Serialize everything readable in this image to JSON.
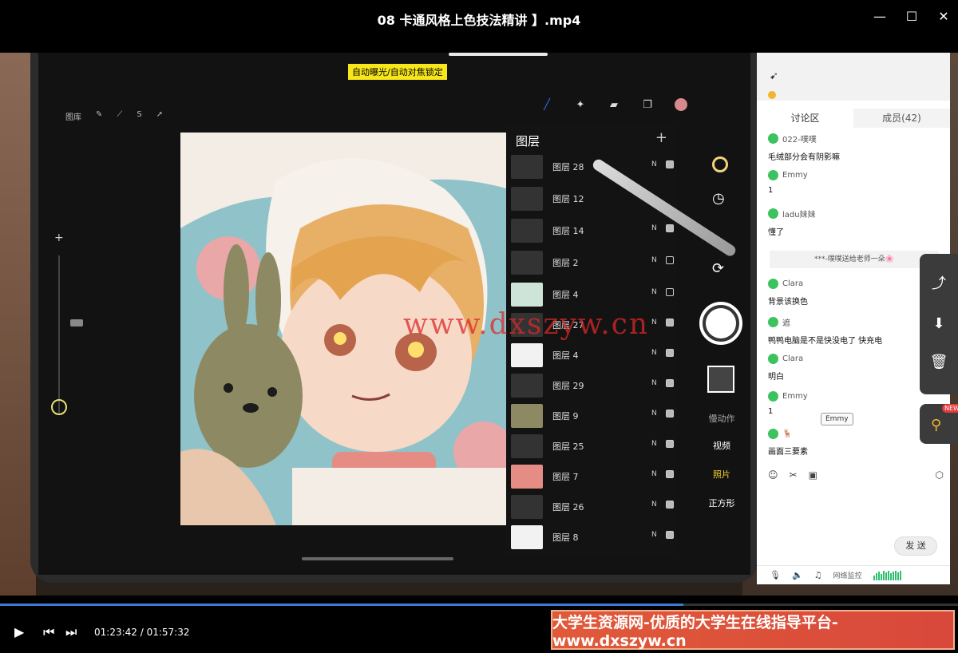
{
  "window": {
    "title": "08 卡通风格上色技法精讲 】.mp4",
    "minimize_icon": "minimize-icon",
    "maximize_icon": "maximize-icon",
    "close_icon": "close-icon"
  },
  "video": {
    "focus_label": "自动曝光/自动对焦锁定",
    "watermark": "www.dxszyw.cn",
    "procreate_toolbar": {
      "gallery": "图库",
      "icons": [
        "wrench-icon",
        "magic-wand-icon",
        "selection-icon",
        "arrow-icon"
      ],
      "right_icons": [
        "brush-icon",
        "smudge-icon",
        "eraser-icon",
        "layers-icon",
        "color-swatch-icon"
      ]
    },
    "layers": {
      "title": "图层",
      "items": [
        {
          "name": "图层 28",
          "mode": "N",
          "checked": true
        },
        {
          "name": "图层 12",
          "mode": "",
          "checked": false
        },
        {
          "name": "图层 14",
          "mode": "N",
          "checked": true
        },
        {
          "name": "图层 2",
          "mode": "N",
          "checked": false
        },
        {
          "name": "图层 4",
          "mode": "N",
          "checked": false
        },
        {
          "name": "图层 27",
          "mode": "N",
          "checked": true
        },
        {
          "name": "图层 4",
          "mode": "N",
          "checked": true
        },
        {
          "name": "图层 29",
          "mode": "N",
          "checked": true
        },
        {
          "name": "图层 9",
          "mode": "N",
          "checked": true
        },
        {
          "name": "图层 25",
          "mode": "N",
          "checked": true
        },
        {
          "name": "图层 7",
          "mode": "N",
          "checked": true
        },
        {
          "name": "图层 26",
          "mode": "N",
          "checked": true
        },
        {
          "name": "图层 8",
          "mode": "N",
          "checked": true
        }
      ]
    },
    "camera": {
      "slow_motion": "慢动作",
      "video": "视频",
      "photo": "照片",
      "square": "正方形"
    }
  },
  "chat": {
    "tabs": {
      "discussion": "讨论区",
      "members": "成员(42)"
    },
    "messages": [
      {
        "user": "022-噗噗",
        "text": "毛绒部分会有阴影嘛"
      },
      {
        "user": "Emmy",
        "text": "1"
      },
      {
        "user": "ladu妹妹",
        "text": "懂了"
      },
      {
        "user": "Clara",
        "text": "背景该换色"
      },
      {
        "user": "遮",
        "text": "鸭鸭电脑是不是快没电了 快充电"
      },
      {
        "user": "Clara",
        "text": "明白"
      },
      {
        "user": "Emmy",
        "text": "1"
      },
      {
        "user": "🦌",
        "text": "画面三要素"
      }
    ],
    "gift_notice": "***-噗噗送给老师一朵🌸",
    "tooltip": "Emmy",
    "send_label": "发 送",
    "network_label": "网络监控"
  },
  "player": {
    "time": "01:23:42 / 01:57:32",
    "progress": 0.713,
    "ad_banner": "大学生资源网-优质的大学生在线指导平台-www.dxszyw.cn",
    "new_tag": "NEW"
  }
}
